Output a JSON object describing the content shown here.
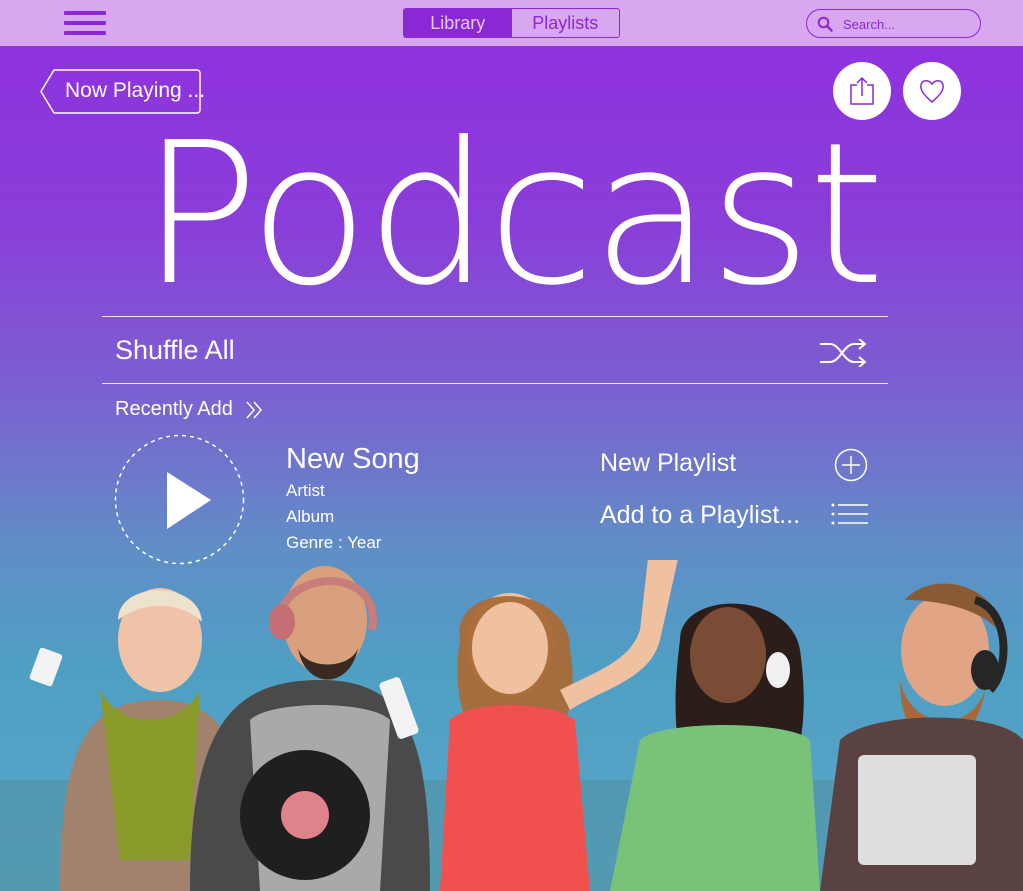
{
  "topbar": {
    "tabs": [
      {
        "label": "Library",
        "active": true
      },
      {
        "label": "Playlists",
        "active": false
      }
    ],
    "search": {
      "placeholder": "Search..."
    }
  },
  "header": {
    "back_label": "Now Playing ...",
    "title": "Podcast"
  },
  "shuffle": {
    "label": "Shuffle All"
  },
  "recently": {
    "label": "Recently Add"
  },
  "song": {
    "title": "New Song",
    "artist": "Artist",
    "album": "Album",
    "genre_year": "Genre : Year"
  },
  "playlist_actions": {
    "new": "New Playlist",
    "add": "Add to a Playlist..."
  },
  "colors": {
    "accent": "#8a28d6",
    "topbar": "#d9a6f0",
    "gradient_top": "#8f2fe0",
    "gradient_bottom": "#5aa7c8"
  },
  "icons": [
    "menu-icon",
    "search-icon",
    "share-icon",
    "heart-icon",
    "shuffle-icon",
    "chevrons-right-icon",
    "play-icon",
    "plus-circle-icon",
    "list-icon"
  ]
}
